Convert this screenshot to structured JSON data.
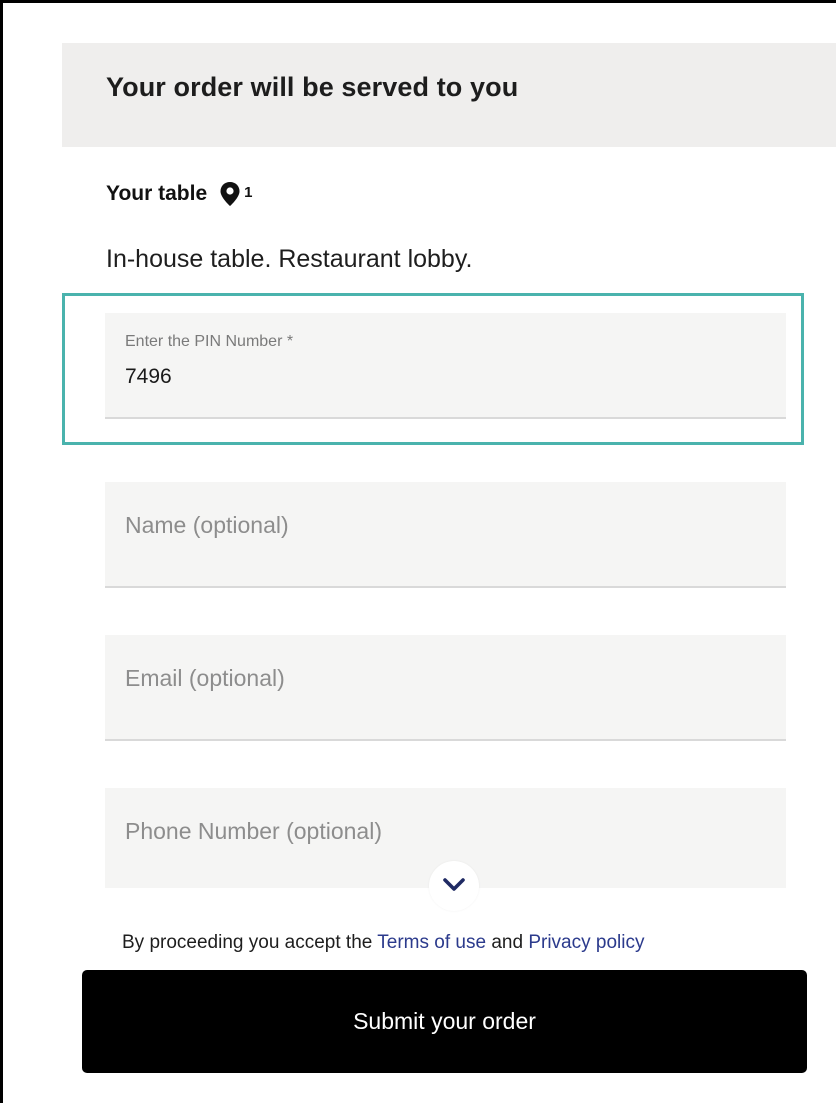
{
  "header": {
    "title": "Your order will be served to you"
  },
  "table": {
    "label": "Your table",
    "number": "1",
    "icon": "map-pin-icon",
    "description": "In-house table. Restaurant lobby."
  },
  "form": {
    "pin": {
      "label": "Enter the PIN Number *",
      "value": "7496"
    },
    "name": {
      "placeholder": "Name (optional)"
    },
    "email": {
      "placeholder": "Email (optional)"
    },
    "phone": {
      "placeholder": "Phone Number (optional)"
    }
  },
  "scroll_indicator": {
    "icon": "chevron-down-icon"
  },
  "terms": {
    "prefix": "By proceeding you accept the ",
    "terms_link": "Terms of use",
    "connector": " and ",
    "privacy_link": "Privacy policy"
  },
  "submit": {
    "label": "Submit your order"
  },
  "colors": {
    "focus_border": "#4ab3ad",
    "link": "#2b3a8c",
    "button_bg": "#000000",
    "header_bg": "#efeeed"
  }
}
